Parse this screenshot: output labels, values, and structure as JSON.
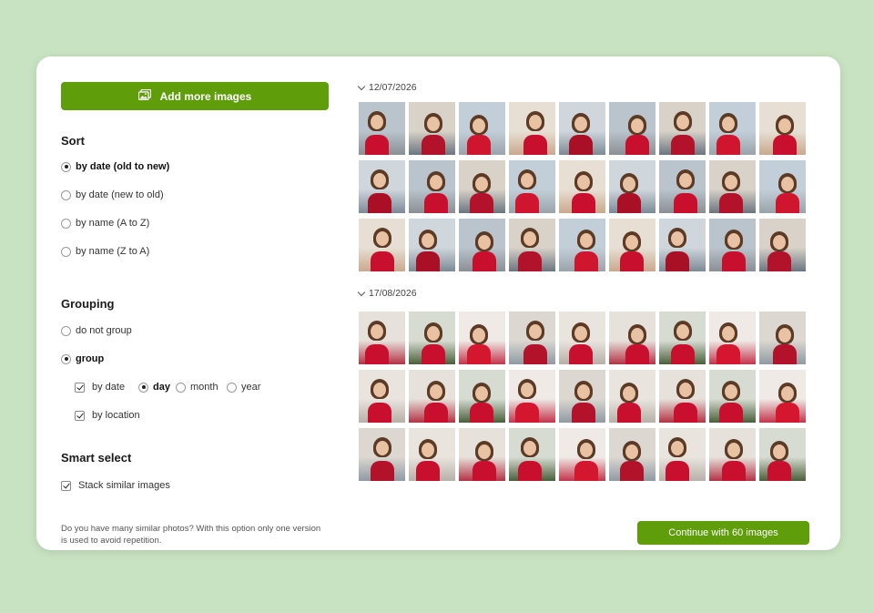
{
  "add_button": {
    "label": "Add more images",
    "icon": "images-icon"
  },
  "sort": {
    "title": "Sort",
    "options": [
      {
        "label": "by date (old to new)",
        "selected": true
      },
      {
        "label": "by date (new to old)",
        "selected": false
      },
      {
        "label": "by name (A to Z)",
        "selected": false
      },
      {
        "label": "by name (Z to A)",
        "selected": false
      }
    ]
  },
  "grouping": {
    "title": "Grouping",
    "options": [
      {
        "label": "do not group",
        "selected": false
      },
      {
        "label": "group",
        "selected": true
      }
    ],
    "by_date": {
      "label": "by date",
      "checked": true
    },
    "granularity": [
      {
        "label": "day",
        "selected": true
      },
      {
        "label": "month",
        "selected": false
      },
      {
        "label": "year",
        "selected": false
      }
    ],
    "by_location": {
      "label": "by location",
      "checked": true
    }
  },
  "smart_select": {
    "title": "Smart select",
    "stack": {
      "label": "Stack similar images",
      "checked": true
    },
    "help": "Do you have many similar photos? With this option only one version is used to avoid repetition."
  },
  "groups": [
    {
      "date": "12/07/2026",
      "count": 27
    },
    {
      "date": "17/08/2026",
      "count": 27
    }
  ],
  "continue_button": {
    "label": "Continue with 60 images"
  },
  "colors": {
    "background": "#c8e3c2",
    "accent": "#5f9e0a",
    "card": "#ffffff"
  }
}
